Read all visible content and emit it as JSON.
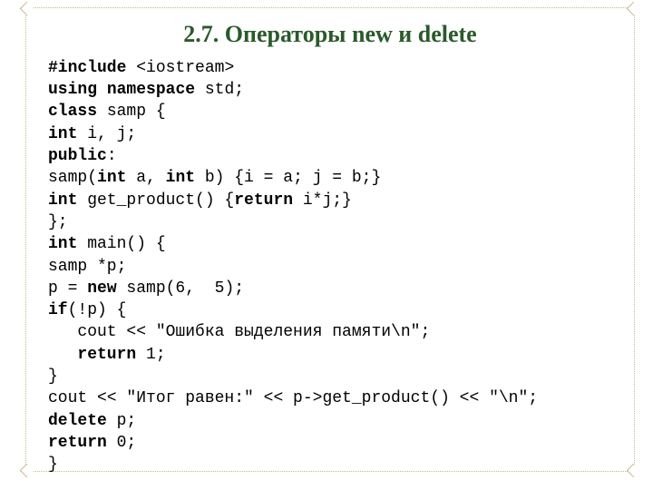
{
  "heading": "2.7. Операторы new и delete",
  "code": {
    "l1_kw": "#include",
    "l1_rest": " <iostream>",
    "l2_kw1": "using",
    "l2_kw2": "namespace",
    "l2_rest": " std;",
    "l3_kw": "class",
    "l3_rest": " samp {",
    "l4_kw": "int",
    "l4_rest": " i, j;",
    "l5_kw": "public",
    "l5_rest": ":",
    "l6_a": "samp(",
    "l6_kw1": "int",
    "l6_b": " a, ",
    "l6_kw2": "int",
    "l6_c": " b) {i = a; j = b;}",
    "l7_kw1": "int",
    "l7_a": " get_product() {",
    "l7_kw2": "return",
    "l7_b": " i*j;}",
    "l8": "};",
    "l9_kw": "int",
    "l9_rest": " main() {",
    "l10": "samp *p;",
    "l11_a": "p = ",
    "l11_kw": "new",
    "l11_b": " samp(6,  5);",
    "l12_kw": "if",
    "l12_rest": "(!p) {",
    "l13": "   cout << \"Ошибка выделения памяти\\n\";",
    "l14_pad": "   ",
    "l14_kw": "return",
    "l14_rest": " 1;",
    "l15": "}",
    "l16": "cout << \"Итог равен:\" << p->get_product() << \"\\n\";",
    "l17_kw": "delete",
    "l17_rest": " p;",
    "l18_kw": "return",
    "l18_rest": " 0;",
    "l19": "}"
  }
}
